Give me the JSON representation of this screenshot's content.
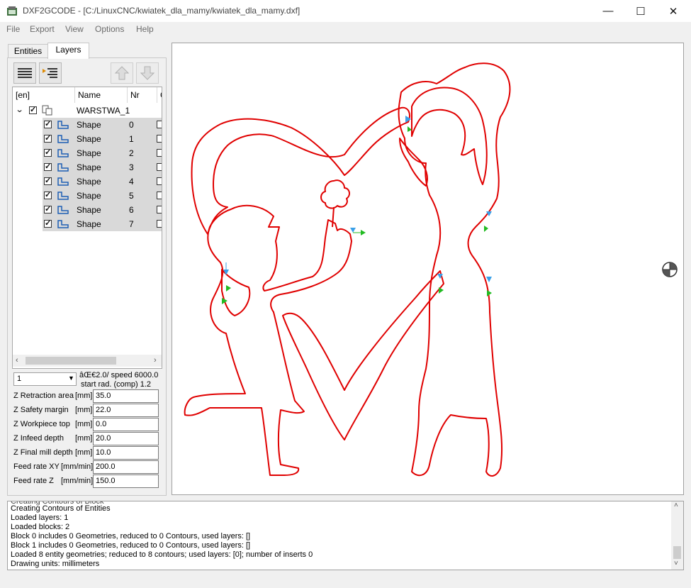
{
  "window": {
    "title": "DXF2GCODE - [C:/LinuxCNC/kwiatek_dla_mamy/kwiatek_dla_mamy.dxf]",
    "minimize": "—",
    "maximize": "☐",
    "close": "✕"
  },
  "menu": [
    "File",
    "Export",
    "View",
    "Options",
    "Help"
  ],
  "tabs": {
    "entities": "Entities",
    "layers": "Layers"
  },
  "tree": {
    "headers": {
      "col1": "[en]",
      "col2": "Name",
      "col3": "Nr",
      "col4": "C"
    },
    "layer": {
      "name": "WARSTWA_1",
      "checked": true
    },
    "shapes": [
      {
        "name": "Shape",
        "nr": "0"
      },
      {
        "name": "Shape",
        "nr": "1"
      },
      {
        "name": "Shape",
        "nr": "2"
      },
      {
        "name": "Shape",
        "nr": "3"
      },
      {
        "name": "Shape",
        "nr": "4"
      },
      {
        "name": "Shape",
        "nr": "5"
      },
      {
        "name": "Shape",
        "nr": "6"
      },
      {
        "name": "Shape",
        "nr": "7"
      }
    ]
  },
  "tool": {
    "selected": "1",
    "info_line1": "âŒ€2.0/ speed 6000.0",
    "info_line2": "start rad. (comp)  1.2"
  },
  "params": [
    {
      "label": "Z Retraction area",
      "unit": "[mm]",
      "value": "35.0"
    },
    {
      "label": "Z Safety margin",
      "unit": "[mm]",
      "value": "22.0"
    },
    {
      "label": "Z Workpiece top",
      "unit": "[mm]",
      "value": "0.0"
    },
    {
      "label": "Z Infeed depth",
      "unit": "[mm]",
      "value": "20.0"
    },
    {
      "label": "Z Final mill depth",
      "unit": "[mm]",
      "value": "10.0"
    },
    {
      "label": "Feed rate XY",
      "unit": "[mm/min]",
      "value": "200.0"
    },
    {
      "label": "Feed rate Z",
      "unit": "[mm/min]",
      "value": "150.0"
    }
  ],
  "log": [
    "Creating Contours of Entities",
    "Loaded layers: 1",
    "Loaded blocks: 2",
    "Block 0 includes 0 Geometries, reduced to 0 Contours, used layers: []",
    "Block 1 includes 0 Geometries, reduced to 0 Contours, used layers: []",
    "Loaded 8 entity geometries; reduced to 8 contours; used layers: [0]; number of inserts 0",
    "Drawing units: millimeters"
  ],
  "colors": {
    "contour": "#e00000",
    "arrow_start": "#22bb22",
    "arrow_dir": "#3aa0e8"
  }
}
